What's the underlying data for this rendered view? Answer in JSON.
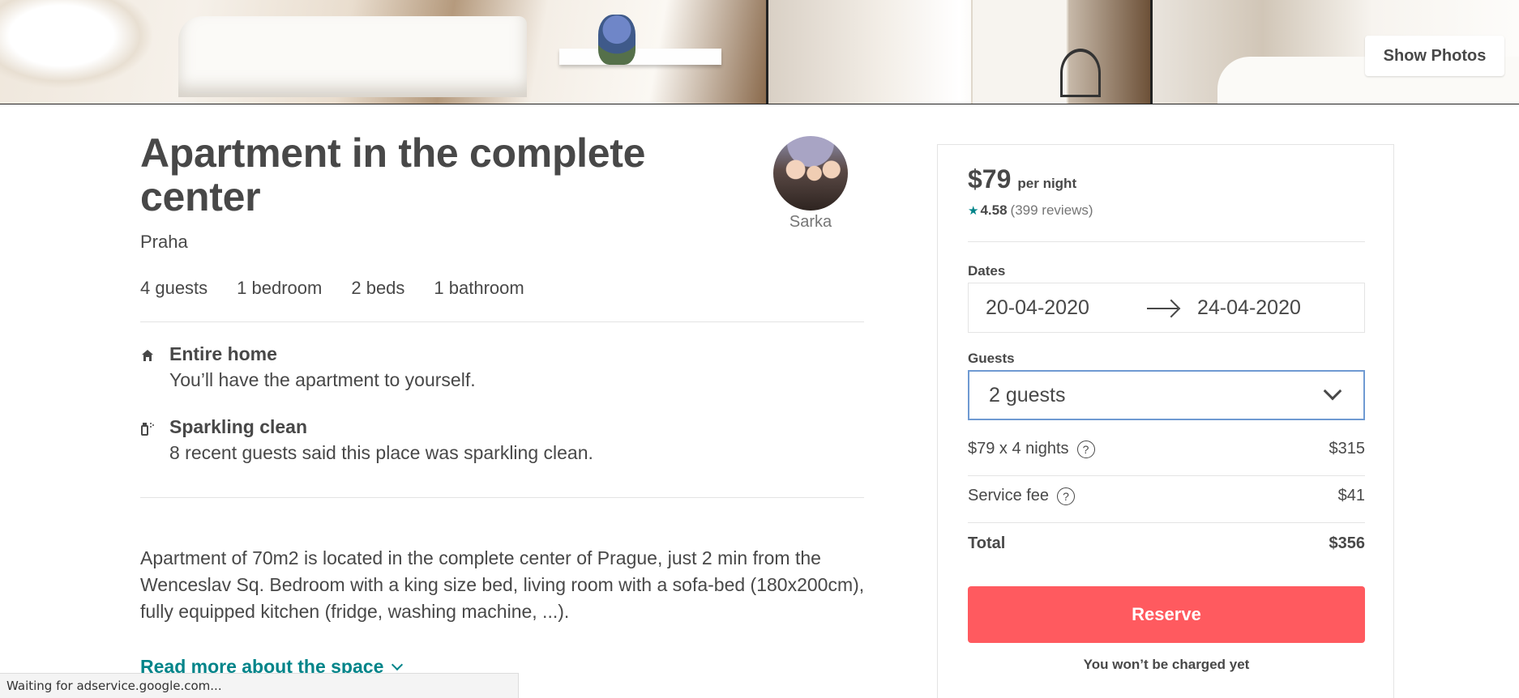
{
  "photos": {
    "show_photos_label": "Show Photos"
  },
  "listing": {
    "title": "Apartment in the complete center",
    "city": "Praha",
    "host_name": "Sarka",
    "stats": [
      "4 guests",
      "1 bedroom",
      "2 beds",
      "1 bathroom"
    ],
    "features": [
      {
        "icon": "home-icon",
        "title": "Entire home",
        "desc": "You’ll have the apartment to yourself."
      },
      {
        "icon": "spray-bottle-icon",
        "title": "Sparkling clean",
        "desc": "8 recent guests said this place was sparkling clean."
      }
    ],
    "description": "Apartment of 70m2 is located in the complete center of Prague, just 2 min from the Wenceslav Sq. Bedroom with a king size bed, living room with a sofa-bed (180x200cm), fully equipped kitchen (fridge, washing machine, ...).",
    "read_more": "Read more about the space"
  },
  "booking": {
    "price": "$79",
    "price_unit": "per night",
    "rating": "4.58",
    "reviews": "(399 reviews)",
    "dates_label": "Dates",
    "check_in": "20-04-2020",
    "check_out": "24-04-2020",
    "guests_label": "Guests",
    "guests_value": "2 guests",
    "nights_line": "$79 x 4 nights",
    "nights_total": "$315",
    "service_fee_label": "Service fee",
    "service_fee": "$41",
    "total_label": "Total",
    "total": "$356",
    "reserve_label": "Reserve",
    "note": "You won’t be charged yet"
  },
  "status_bar": "Waiting for adservice.google.com...",
  "colors": {
    "accent": "#ff5a5f",
    "link": "#008489",
    "text": "#484848",
    "focus": "#6f9ad2"
  }
}
